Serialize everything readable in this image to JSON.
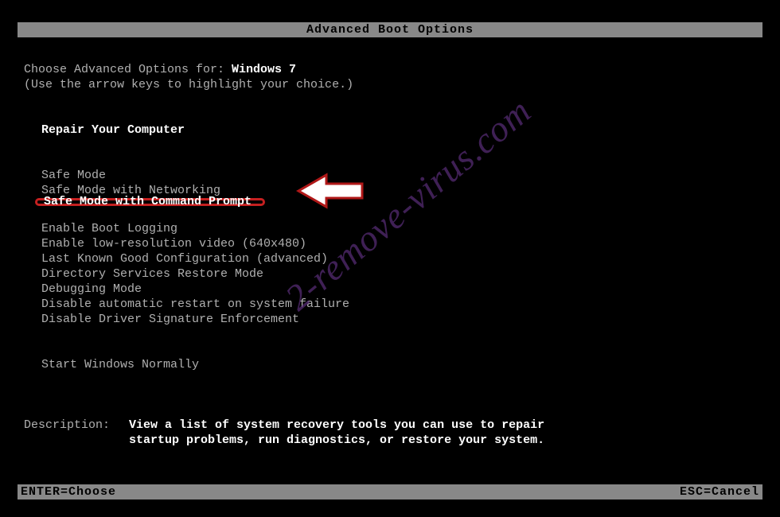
{
  "title": "Advanced Boot Options",
  "prompt_prefix": "Choose Advanced Options for: ",
  "os_name": "Windows 7",
  "instruction": "(Use the arrow keys to highlight your choice.)",
  "menu": {
    "repair": "Repair Your Computer",
    "safe1": "Safe Mode",
    "safe2": "Safe Mode with Networking",
    "safe3": "Safe Mode with Command Prompt",
    "opt1": "Enable Boot Logging",
    "opt2": "Enable low-resolution video (640x480)",
    "opt3": "Last Known Good Configuration (advanced)",
    "opt4": "Directory Services Restore Mode",
    "opt5": "Debugging Mode",
    "opt6": "Disable automatic restart on system failure",
    "opt7": "Disable Driver Signature Enforcement",
    "normal": "Start Windows Normally"
  },
  "desc_label": "Description:",
  "desc_line1": "View a list of system recovery tools you can use to repair",
  "desc_line2": "startup problems, run diagnostics, or restore your system.",
  "footer_left": "ENTER=Choose",
  "footer_right": "ESC=Cancel",
  "watermark": "2-remove-virus.com"
}
